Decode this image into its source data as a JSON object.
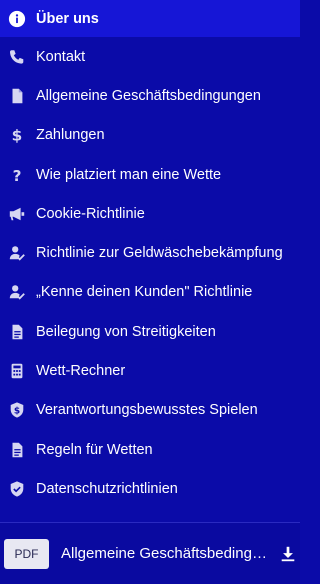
{
  "menu": {
    "items": [
      {
        "label": "Über uns",
        "icon": "info-icon"
      },
      {
        "label": "Kontakt",
        "icon": "phone-icon"
      },
      {
        "label": "Allgemeine Geschäftsbedingungen",
        "icon": "document-icon"
      },
      {
        "label": "Zahlungen",
        "icon": "dollar-icon"
      },
      {
        "label": "Wie platziert man eine Wette",
        "icon": "question-icon"
      },
      {
        "label": "Cookie-Richtlinie",
        "icon": "megaphone-icon"
      },
      {
        "label": "Richtlinie zur Geldwäschebekämpfung",
        "icon": "user-check-icon"
      },
      {
        "label": "„Kenne deinen Kunden\" Richtlinie",
        "icon": "user-check-icon"
      },
      {
        "label": "Beilegung von Streitigkeiten",
        "icon": "document-text-icon"
      },
      {
        "label": "Wett-Rechner",
        "icon": "calculator-icon"
      },
      {
        "label": "Verantwortungsbewusstes Spielen",
        "icon": "shield-dollar-icon"
      },
      {
        "label": "Regeln für Wetten",
        "icon": "document-text-icon"
      },
      {
        "label": "Datenschutzrichtlinien",
        "icon": "shield-check-icon"
      }
    ],
    "active_index": 0
  },
  "footer": {
    "badge": "PDF",
    "label": "Allgemeine Geschäftsbedingungen",
    "download_icon": "download-icon"
  },
  "colors": {
    "background": "#0b0ba8",
    "active": "#1616d6",
    "text": "#ffffff",
    "icon": "#d6d6f2"
  }
}
